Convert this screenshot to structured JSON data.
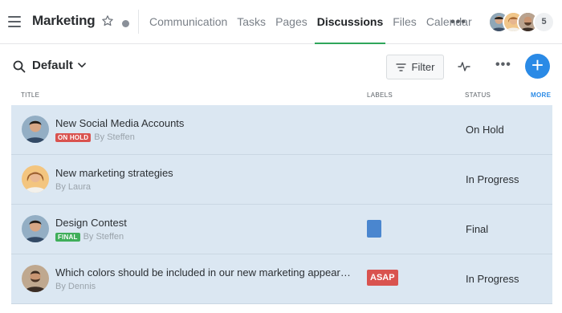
{
  "header": {
    "title": "Marketing",
    "tabs": [
      "Communication",
      "Tasks",
      "Pages",
      "Discussions",
      "Files",
      "Calendar"
    ],
    "active_tab": "Discussions",
    "more_glyph": "•••",
    "member_count": "5"
  },
  "toolbar": {
    "view_label": "Default",
    "filter_label": "Filter",
    "more_glyph": "•••",
    "add_glyph": "+"
  },
  "table": {
    "columns": {
      "title": "TITLE",
      "labels": "LABELS",
      "status": "STATUS",
      "more": "MORE"
    },
    "rows": [
      {
        "title": "New Social Media Accounts",
        "badge": "ON HOLD",
        "badge_color": "#d9534f",
        "author": "By Steffen",
        "label": "",
        "label_color": "",
        "status": "On Hold"
      },
      {
        "title": "New marketing strategies",
        "badge": "",
        "badge_color": "",
        "author": "By Laura",
        "label": "",
        "label_color": "",
        "status": "In Progress"
      },
      {
        "title": "Design Contest",
        "badge": "FINAL",
        "badge_color": "#3fae5a",
        "author": "By Steffen",
        "label": "",
        "label_color": "#4a86cf",
        "status": "Final"
      },
      {
        "title": "Which colors should be included in our new marketing appeara…",
        "badge": "",
        "badge_color": "",
        "author": "By Dennis",
        "label": "ASAP",
        "label_color": "#d9534f",
        "status": "In Progress"
      }
    ]
  },
  "colors": {
    "accent": "#2a8ae6",
    "active_tab_underline": "#2fa65b",
    "row_background": "#dbe7f2"
  }
}
